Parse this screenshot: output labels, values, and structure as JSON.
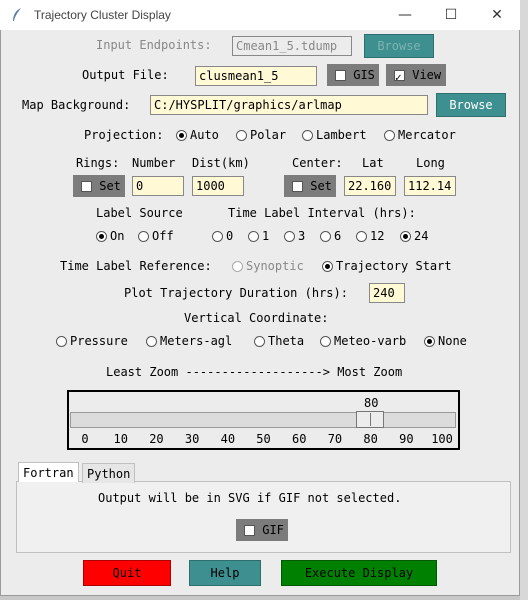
{
  "window": {
    "title": "Trajectory Cluster Display",
    "controls": [
      "—",
      "☐",
      "✕"
    ]
  },
  "input_endpoints": {
    "label": "Input Endpoints:",
    "value": "Cmean1_5.tdump",
    "browse": "Browse"
  },
  "output_file": {
    "label": "Output File:",
    "value": "clusmean1_5",
    "gis_label": "GIS",
    "view_label": "View"
  },
  "map_background": {
    "label": "Map Background:",
    "value": "C:/HYSPLIT/graphics/arlmap",
    "browse": "Browse"
  },
  "projection": {
    "label": "Projection:",
    "options": [
      "Auto",
      "Polar",
      "Lambert",
      "Mercator"
    ],
    "selected": "Auto"
  },
  "rings": {
    "label": "Rings:",
    "number_label": "Number",
    "dist_label": "Dist(km)",
    "set_label": "Set",
    "number": "0",
    "dist": "1000"
  },
  "center": {
    "label": "Center:",
    "lat_label": "Lat",
    "long_label": "Long",
    "set_label": "Set",
    "lat": "22.160",
    "long": "112.14"
  },
  "label_source": {
    "label": "Label Source",
    "options": [
      "On",
      "Off"
    ],
    "selected": "On"
  },
  "time_label_interval": {
    "label": "Time Label Interval (hrs):",
    "options": [
      "0",
      "1",
      "3",
      "6",
      "12",
      "24"
    ],
    "selected": "24"
  },
  "time_label_reference": {
    "label": "Time Label Reference:",
    "options": [
      "Synoptic",
      "Trajectory Start"
    ],
    "selected": "Trajectory Start"
  },
  "plot_duration": {
    "label": "Plot Trajectory Duration (hrs):",
    "value": "240"
  },
  "vertical": {
    "label": "Vertical Coordinate:",
    "options": [
      "Pressure",
      "Meters-agl",
      "Theta",
      "Meteo-varb",
      "None"
    ],
    "selected": "None"
  },
  "zoom": {
    "label": "Least Zoom -------------------> Most Zoom",
    "value": "80",
    "ticks": [
      "0",
      "10",
      "20",
      "30",
      "40",
      "50",
      "60",
      "70",
      "80",
      "90",
      "100"
    ]
  },
  "tabs": {
    "items": [
      "Fortran",
      "Python"
    ],
    "active": "Fortran",
    "message": "Output will be in SVG if GIF not selected.",
    "gif_label": "GIF"
  },
  "buttons": {
    "quit": "Quit",
    "help": "Help",
    "execute": "Execute Display"
  },
  "colors": {
    "teal": "#3e8f8f",
    "quit_red": "#ff0000",
    "execute_green": "#008000",
    "entry_bg": "#fff9d6"
  }
}
